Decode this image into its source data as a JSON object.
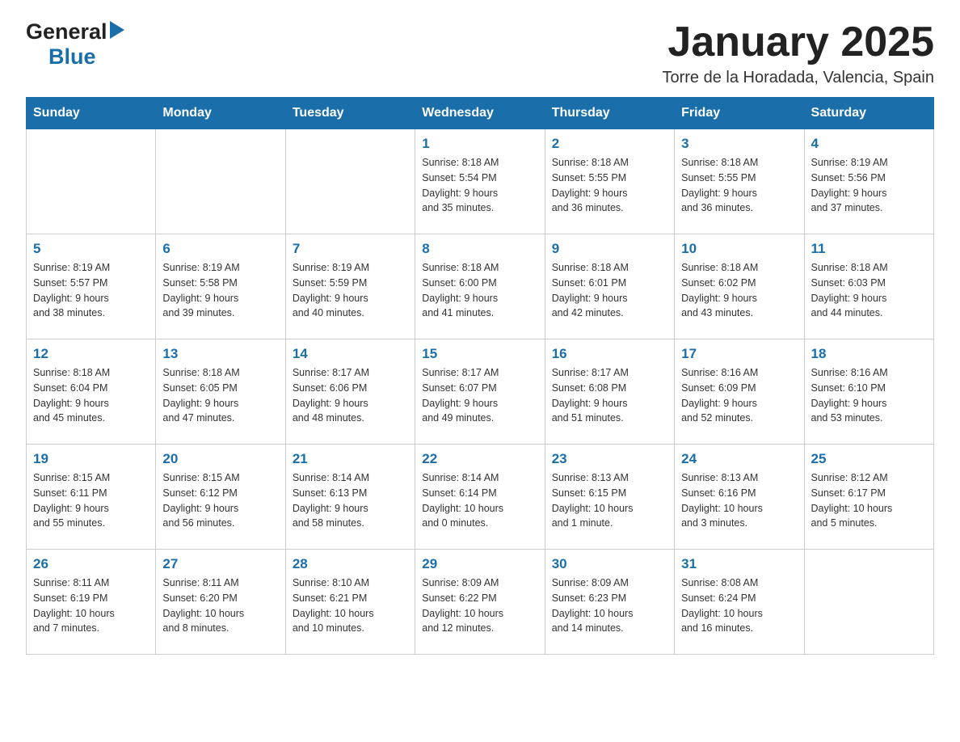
{
  "header": {
    "month_title": "January 2025",
    "location": "Torre de la Horadada, Valencia, Spain",
    "logo_general": "General",
    "logo_blue": "Blue"
  },
  "weekdays": [
    "Sunday",
    "Monday",
    "Tuesday",
    "Wednesday",
    "Thursday",
    "Friday",
    "Saturday"
  ],
  "weeks": [
    [
      {
        "day": "",
        "info": ""
      },
      {
        "day": "",
        "info": ""
      },
      {
        "day": "",
        "info": ""
      },
      {
        "day": "1",
        "info": "Sunrise: 8:18 AM\nSunset: 5:54 PM\nDaylight: 9 hours\nand 35 minutes."
      },
      {
        "day": "2",
        "info": "Sunrise: 8:18 AM\nSunset: 5:55 PM\nDaylight: 9 hours\nand 36 minutes."
      },
      {
        "day": "3",
        "info": "Sunrise: 8:18 AM\nSunset: 5:55 PM\nDaylight: 9 hours\nand 36 minutes."
      },
      {
        "day": "4",
        "info": "Sunrise: 8:19 AM\nSunset: 5:56 PM\nDaylight: 9 hours\nand 37 minutes."
      }
    ],
    [
      {
        "day": "5",
        "info": "Sunrise: 8:19 AM\nSunset: 5:57 PM\nDaylight: 9 hours\nand 38 minutes."
      },
      {
        "day": "6",
        "info": "Sunrise: 8:19 AM\nSunset: 5:58 PM\nDaylight: 9 hours\nand 39 minutes."
      },
      {
        "day": "7",
        "info": "Sunrise: 8:19 AM\nSunset: 5:59 PM\nDaylight: 9 hours\nand 40 minutes."
      },
      {
        "day": "8",
        "info": "Sunrise: 8:18 AM\nSunset: 6:00 PM\nDaylight: 9 hours\nand 41 minutes."
      },
      {
        "day": "9",
        "info": "Sunrise: 8:18 AM\nSunset: 6:01 PM\nDaylight: 9 hours\nand 42 minutes."
      },
      {
        "day": "10",
        "info": "Sunrise: 8:18 AM\nSunset: 6:02 PM\nDaylight: 9 hours\nand 43 minutes."
      },
      {
        "day": "11",
        "info": "Sunrise: 8:18 AM\nSunset: 6:03 PM\nDaylight: 9 hours\nand 44 minutes."
      }
    ],
    [
      {
        "day": "12",
        "info": "Sunrise: 8:18 AM\nSunset: 6:04 PM\nDaylight: 9 hours\nand 45 minutes."
      },
      {
        "day": "13",
        "info": "Sunrise: 8:18 AM\nSunset: 6:05 PM\nDaylight: 9 hours\nand 47 minutes."
      },
      {
        "day": "14",
        "info": "Sunrise: 8:17 AM\nSunset: 6:06 PM\nDaylight: 9 hours\nand 48 minutes."
      },
      {
        "day": "15",
        "info": "Sunrise: 8:17 AM\nSunset: 6:07 PM\nDaylight: 9 hours\nand 49 minutes."
      },
      {
        "day": "16",
        "info": "Sunrise: 8:17 AM\nSunset: 6:08 PM\nDaylight: 9 hours\nand 51 minutes."
      },
      {
        "day": "17",
        "info": "Sunrise: 8:16 AM\nSunset: 6:09 PM\nDaylight: 9 hours\nand 52 minutes."
      },
      {
        "day": "18",
        "info": "Sunrise: 8:16 AM\nSunset: 6:10 PM\nDaylight: 9 hours\nand 53 minutes."
      }
    ],
    [
      {
        "day": "19",
        "info": "Sunrise: 8:15 AM\nSunset: 6:11 PM\nDaylight: 9 hours\nand 55 minutes."
      },
      {
        "day": "20",
        "info": "Sunrise: 8:15 AM\nSunset: 6:12 PM\nDaylight: 9 hours\nand 56 minutes."
      },
      {
        "day": "21",
        "info": "Sunrise: 8:14 AM\nSunset: 6:13 PM\nDaylight: 9 hours\nand 58 minutes."
      },
      {
        "day": "22",
        "info": "Sunrise: 8:14 AM\nSunset: 6:14 PM\nDaylight: 10 hours\nand 0 minutes."
      },
      {
        "day": "23",
        "info": "Sunrise: 8:13 AM\nSunset: 6:15 PM\nDaylight: 10 hours\nand 1 minute."
      },
      {
        "day": "24",
        "info": "Sunrise: 8:13 AM\nSunset: 6:16 PM\nDaylight: 10 hours\nand 3 minutes."
      },
      {
        "day": "25",
        "info": "Sunrise: 8:12 AM\nSunset: 6:17 PM\nDaylight: 10 hours\nand 5 minutes."
      }
    ],
    [
      {
        "day": "26",
        "info": "Sunrise: 8:11 AM\nSunset: 6:19 PM\nDaylight: 10 hours\nand 7 minutes."
      },
      {
        "day": "27",
        "info": "Sunrise: 8:11 AM\nSunset: 6:20 PM\nDaylight: 10 hours\nand 8 minutes."
      },
      {
        "day": "28",
        "info": "Sunrise: 8:10 AM\nSunset: 6:21 PM\nDaylight: 10 hours\nand 10 minutes."
      },
      {
        "day": "29",
        "info": "Sunrise: 8:09 AM\nSunset: 6:22 PM\nDaylight: 10 hours\nand 12 minutes."
      },
      {
        "day": "30",
        "info": "Sunrise: 8:09 AM\nSunset: 6:23 PM\nDaylight: 10 hours\nand 14 minutes."
      },
      {
        "day": "31",
        "info": "Sunrise: 8:08 AM\nSunset: 6:24 PM\nDaylight: 10 hours\nand 16 minutes."
      },
      {
        "day": "",
        "info": ""
      }
    ]
  ]
}
